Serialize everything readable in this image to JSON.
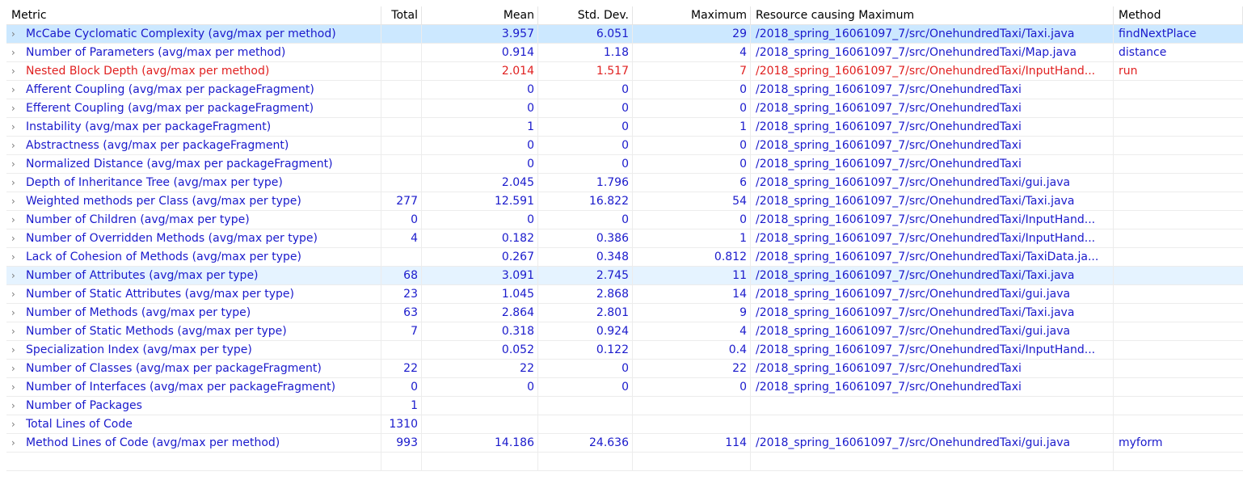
{
  "columns": {
    "metric": "Metric",
    "total": "Total",
    "mean": "Mean",
    "std": "Std. Dev.",
    "max": "Maximum",
    "resource": "Resource causing Maximum",
    "method": "Method"
  },
  "chevron": "›",
  "rows": [
    {
      "metric": "McCabe Cyclomatic Complexity (avg/max per method)",
      "total": "",
      "mean": "3.957",
      "std": "6.051",
      "max": "29",
      "resource": "/2018_spring_16061097_7/src/OnehundredTaxi/Taxi.java",
      "method": "findNextPlace"
    },
    {
      "metric": "Number of Parameters (avg/max per method)",
      "total": "",
      "mean": "0.914",
      "std": "1.18",
      "max": "4",
      "resource": "/2018_spring_16061097_7/src/OnehundredTaxi/Map.java",
      "method": "distance"
    },
    {
      "metric": "Nested Block Depth (avg/max per method)",
      "total": "",
      "mean": "2.014",
      "std": "1.517",
      "max": "7",
      "resource": "/2018_spring_16061097_7/src/OnehundredTaxi/InputHand...",
      "method": "run"
    },
    {
      "metric": "Afferent Coupling (avg/max per packageFragment)",
      "total": "",
      "mean": "0",
      "std": "0",
      "max": "0",
      "resource": "/2018_spring_16061097_7/src/OnehundredTaxi",
      "method": ""
    },
    {
      "metric": "Efferent Coupling (avg/max per packageFragment)",
      "total": "",
      "mean": "0",
      "std": "0",
      "max": "0",
      "resource": "/2018_spring_16061097_7/src/OnehundredTaxi",
      "method": ""
    },
    {
      "metric": "Instability (avg/max per packageFragment)",
      "total": "",
      "mean": "1",
      "std": "0",
      "max": "1",
      "resource": "/2018_spring_16061097_7/src/OnehundredTaxi",
      "method": ""
    },
    {
      "metric": "Abstractness (avg/max per packageFragment)",
      "total": "",
      "mean": "0",
      "std": "0",
      "max": "0",
      "resource": "/2018_spring_16061097_7/src/OnehundredTaxi",
      "method": ""
    },
    {
      "metric": "Normalized Distance (avg/max per packageFragment)",
      "total": "",
      "mean": "0",
      "std": "0",
      "max": "0",
      "resource": "/2018_spring_16061097_7/src/OnehundredTaxi",
      "method": ""
    },
    {
      "metric": "Depth of Inheritance Tree (avg/max per type)",
      "total": "",
      "mean": "2.045",
      "std": "1.796",
      "max": "6",
      "resource": "/2018_spring_16061097_7/src/OnehundredTaxi/gui.java",
      "method": ""
    },
    {
      "metric": "Weighted methods per Class (avg/max per type)",
      "total": "277",
      "mean": "12.591",
      "std": "16.822",
      "max": "54",
      "resource": "/2018_spring_16061097_7/src/OnehundredTaxi/Taxi.java",
      "method": ""
    },
    {
      "metric": "Number of Children (avg/max per type)",
      "total": "0",
      "mean": "0",
      "std": "0",
      "max": "0",
      "resource": "/2018_spring_16061097_7/src/OnehundredTaxi/InputHand...",
      "method": ""
    },
    {
      "metric": "Number of Overridden Methods (avg/max per type)",
      "total": "4",
      "mean": "0.182",
      "std": "0.386",
      "max": "1",
      "resource": "/2018_spring_16061097_7/src/OnehundredTaxi/InputHand...",
      "method": ""
    },
    {
      "metric": "Lack of Cohesion of Methods (avg/max per type)",
      "total": "",
      "mean": "0.267",
      "std": "0.348",
      "max": "0.812",
      "resource": "/2018_spring_16061097_7/src/OnehundredTaxi/TaxiData.ja...",
      "method": ""
    },
    {
      "metric": "Number of Attributes (avg/max per type)",
      "total": "68",
      "mean": "3.091",
      "std": "2.745",
      "max": "11",
      "resource": "/2018_spring_16061097_7/src/OnehundredTaxi/Taxi.java",
      "method": ""
    },
    {
      "metric": "Number of Static Attributes (avg/max per type)",
      "total": "23",
      "mean": "1.045",
      "std": "2.868",
      "max": "14",
      "resource": "/2018_spring_16061097_7/src/OnehundredTaxi/gui.java",
      "method": ""
    },
    {
      "metric": "Number of Methods (avg/max per type)",
      "total": "63",
      "mean": "2.864",
      "std": "2.801",
      "max": "9",
      "resource": "/2018_spring_16061097_7/src/OnehundredTaxi/Taxi.java",
      "method": ""
    },
    {
      "metric": "Number of Static Methods (avg/max per type)",
      "total": "7",
      "mean": "0.318",
      "std": "0.924",
      "max": "4",
      "resource": "/2018_spring_16061097_7/src/OnehundredTaxi/gui.java",
      "method": ""
    },
    {
      "metric": "Specialization Index (avg/max per type)",
      "total": "",
      "mean": "0.052",
      "std": "0.122",
      "max": "0.4",
      "resource": "/2018_spring_16061097_7/src/OnehundredTaxi/InputHand...",
      "method": ""
    },
    {
      "metric": "Number of Classes (avg/max per packageFragment)",
      "total": "22",
      "mean": "22",
      "std": "0",
      "max": "22",
      "resource": "/2018_spring_16061097_7/src/OnehundredTaxi",
      "method": ""
    },
    {
      "metric": "Number of Interfaces (avg/max per packageFragment)",
      "total": "0",
      "mean": "0",
      "std": "0",
      "max": "0",
      "resource": "/2018_spring_16061097_7/src/OnehundredTaxi",
      "method": ""
    },
    {
      "metric": "Number of Packages",
      "total": "1",
      "mean": "",
      "std": "",
      "max": "",
      "resource": "",
      "method": ""
    },
    {
      "metric": "Total Lines of Code",
      "total": "1310",
      "mean": "",
      "std": "",
      "max": "",
      "resource": "",
      "method": ""
    },
    {
      "metric": "Method Lines of Code (avg/max per method)",
      "total": "993",
      "mean": "14.186",
      "std": "24.636",
      "max": "114",
      "resource": "/2018_spring_16061097_7/src/OnehundredTaxi/gui.java",
      "method": "myform"
    }
  ],
  "colors": {
    "text": "#1a1acc",
    "error": "#e02020",
    "selected": "#cce8ff",
    "hover": "#e5f3ff"
  }
}
